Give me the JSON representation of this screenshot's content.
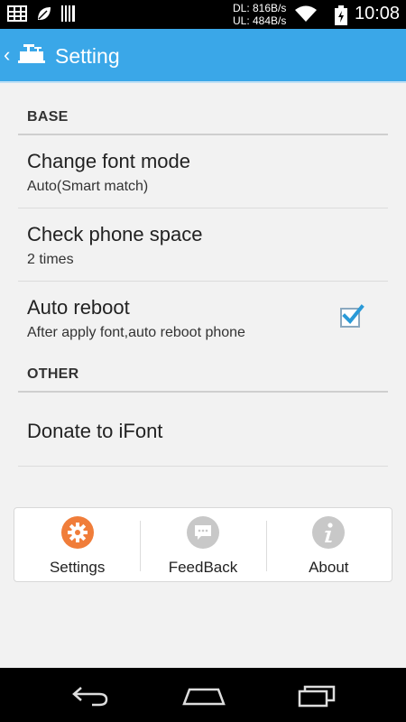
{
  "status_bar": {
    "network_down": "DL: 816B/s",
    "network_up": "UL: 484B/s",
    "time": "10:08",
    "icons": [
      "grid-icon",
      "leaf-icon",
      "barcode-icon",
      "wifi-icon",
      "battery-icon"
    ]
  },
  "app_bar": {
    "title": "Setting",
    "color": "#3aa7e8"
  },
  "sections": {
    "base": {
      "header": "BASE",
      "items": [
        {
          "title": "Change font mode",
          "subtitle": "Auto(Smart match)"
        },
        {
          "title": "Check phone space",
          "subtitle": "2 times"
        },
        {
          "title": "Auto reboot",
          "subtitle": "After apply font,auto reboot phone",
          "checked": true
        }
      ]
    },
    "other": {
      "header": "OTHER",
      "items": [
        {
          "title": "Donate to iFont"
        }
      ]
    }
  },
  "tabs": [
    {
      "label": "Settings",
      "icon": "gear-icon",
      "active": true,
      "color": "#f07d3a"
    },
    {
      "label": "FeedBack",
      "icon": "chat-icon",
      "active": false,
      "color": "#c8c8c8"
    },
    {
      "label": "About",
      "icon": "info-icon",
      "active": false,
      "color": "#c8c8c8"
    }
  ],
  "nav_bar": {
    "icons": [
      "back-icon",
      "home-icon",
      "recents-icon"
    ]
  }
}
